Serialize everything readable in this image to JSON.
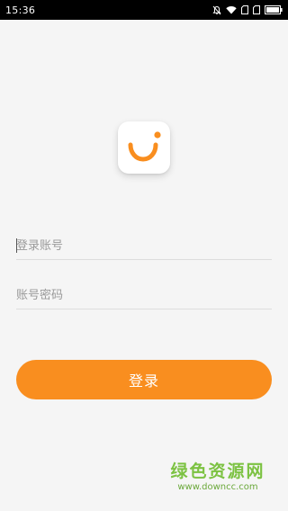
{
  "status_bar": {
    "time": "15:36",
    "icons": [
      "mute-icon",
      "wifi-icon",
      "sim-card-icon",
      "sim-card-icon",
      "battery-icon"
    ]
  },
  "app": {
    "logo_icon": "smile-logo-icon",
    "accent_color": "#f98e1f"
  },
  "form": {
    "account_placeholder": "登录账号",
    "account_value": "",
    "password_placeholder": "账号密码",
    "password_value": "",
    "login_label": "登录"
  },
  "watermark": {
    "title": "绿色资源网",
    "url": "www.downcc.com"
  }
}
